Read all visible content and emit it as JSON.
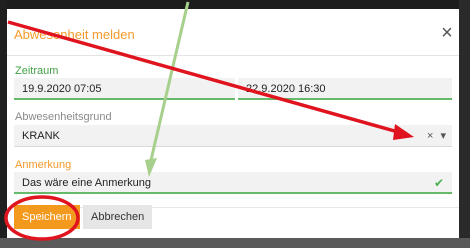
{
  "dialog": {
    "title": "Abwesenheit melden",
    "close_glyph": "×"
  },
  "zeitraum": {
    "label": "Zeitraum",
    "from": "19.9.2020 07:05",
    "to": "22.9.2020 16:30"
  },
  "grund": {
    "label": "Abwesenheitsgrund",
    "value": "KRANK",
    "clear_glyph": "×",
    "dropdown_glyph": "▾"
  },
  "anmerkung": {
    "label": "Anmerkung",
    "value": "Das wäre eine Anmerkung",
    "valid_glyph": "✔"
  },
  "buttons": {
    "save": "Speichern",
    "cancel": "Abbrechen"
  },
  "annotations": {
    "red_color": "#e0141e",
    "green_color": "#a8d08d"
  }
}
